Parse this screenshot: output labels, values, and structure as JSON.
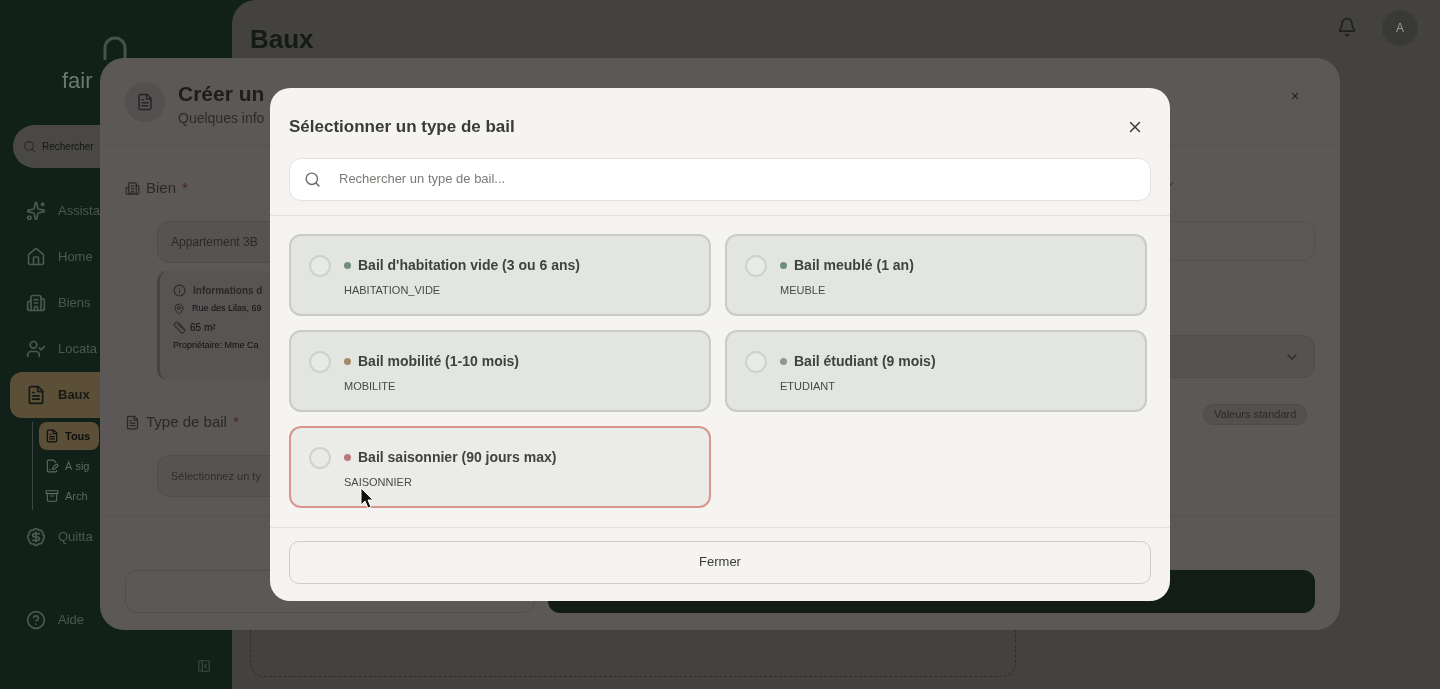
{
  "sidebar": {
    "logo": "fair",
    "search_placeholder": "Rechercher",
    "items": [
      {
        "label": "Assista",
        "selected": false
      },
      {
        "label": "Home",
        "selected": false
      },
      {
        "label": "Biens",
        "selected": false
      },
      {
        "label": "Locata",
        "selected": false
      },
      {
        "label": "Baux",
        "selected": true,
        "children": [
          {
            "label": "Tous",
            "selected": true
          },
          {
            "label": "À sig",
            "selected": false
          },
          {
            "label": "Arch",
            "selected": false
          }
        ]
      },
      {
        "label": "Quitta",
        "selected": false
      }
    ],
    "footer_items": [
      {
        "label": "Aide"
      }
    ]
  },
  "page": {
    "title": "Baux"
  },
  "header": {
    "avatar": "A"
  },
  "create_dialog": {
    "title": "Créer un",
    "subtitle": "Quelques info",
    "close": "×",
    "property_label": "Bien",
    "property_required": "*",
    "property_value": "Appartement 3B",
    "info": {
      "title": "Informations d",
      "address": "Rue des Lilas, 69",
      "area": "65 m²",
      "owner": "Propriétaire: Mme Ca"
    },
    "type_label": "Type de bail",
    "type_required": "*",
    "type_placeholder": "Sélectionnez un ty",
    "badge": "Valeurs standard"
  },
  "type_dialog": {
    "title": "Sélectionner un type de bail",
    "search_placeholder": "Rechercher un type de bail...",
    "options": [
      {
        "label": "Bail d'habitation vide (3 ou 6 ans)",
        "code": "HABITATION_VIDE",
        "color": "#6f8f7a",
        "selected": false,
        "hovered": false
      },
      {
        "label": "Bail meublé (1 an)",
        "code": "MEUBLE",
        "color": "#6f8f7a",
        "selected": false,
        "hovered": false
      },
      {
        "label": "Bail mobilité (1-10 mois)",
        "code": "MOBILITE",
        "color": "#a08a6a",
        "selected": false,
        "hovered": false
      },
      {
        "label": "Bail étudiant (9 mois)",
        "code": "ETUDIANT",
        "color": "#8f9691",
        "selected": false,
        "hovered": false
      },
      {
        "label": "Bail saisonnier (90 jours max)",
        "code": "SAISONNIER",
        "color": "#b87a78",
        "selected": false,
        "hovered": true
      }
    ],
    "close_button": "Fermer"
  }
}
